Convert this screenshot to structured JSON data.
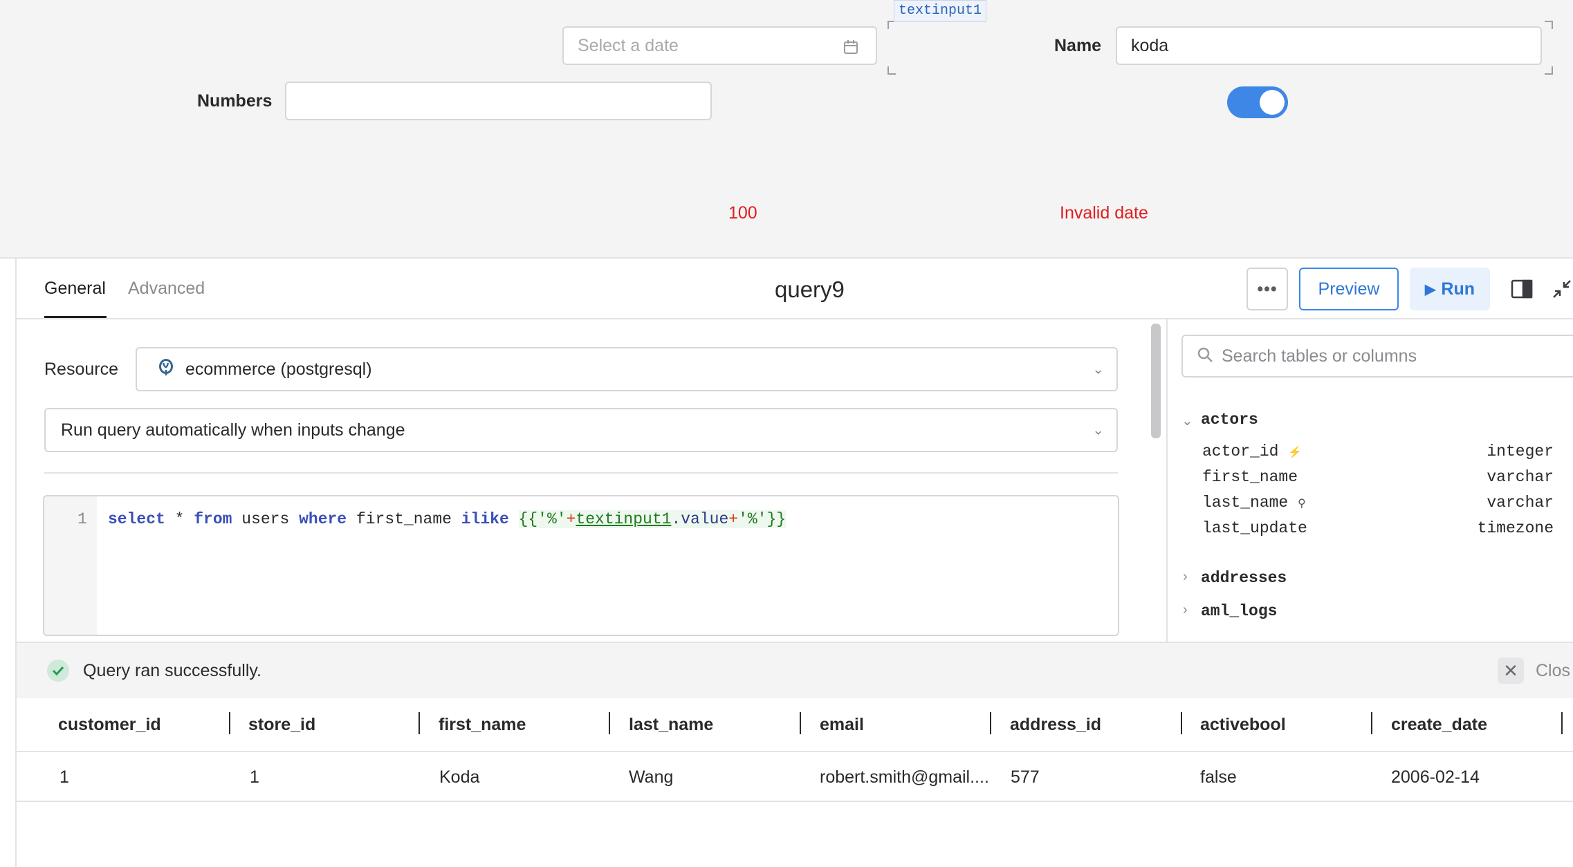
{
  "canvas": {
    "date_input": {
      "placeholder": "Select a date",
      "icon": "calendar-icon"
    },
    "numbers_field": {
      "label": "Numbers",
      "value": ""
    },
    "name_field": {
      "label": "Name",
      "value": "koda",
      "component_tag": "textinput1"
    },
    "toggle": {
      "state": "on",
      "color": "#3e87e6"
    },
    "number_text": "100",
    "date_error_text": "Invalid date",
    "error_color": "#e11d1d"
  },
  "editor": {
    "tabs": [
      {
        "label": "General",
        "active": true
      },
      {
        "label": "Advanced",
        "active": false
      }
    ],
    "query_name": "query9",
    "buttons": {
      "more": "•••",
      "preview": "Preview",
      "run": "Run"
    },
    "resource": {
      "label": "Resource",
      "value": "ecommerce (postgresql)",
      "icon": "postgresql-elephant-icon"
    },
    "trigger": {
      "value": "Run query automatically when inputs change"
    },
    "code": {
      "line_number": "1",
      "kw_select": "select",
      "star": " * ",
      "kw_from": "from",
      "table": " users ",
      "kw_where": "where",
      "column": " first_name ",
      "kw_ilike": "ilike",
      "t_open": "{{'%'",
      "t_plus1": "+",
      "t_ref": "textinput1",
      "t_prop": ".value",
      "t_plus2": "+",
      "t_close": "'%'}}"
    }
  },
  "schema": {
    "search_placeholder": "Search tables or columns",
    "tables": [
      {
        "name": "actors",
        "expanded": true,
        "columns": [
          {
            "name": "actor_id",
            "type": "integer",
            "icon": "primary-key-icon"
          },
          {
            "name": "first_name",
            "type": "varchar"
          },
          {
            "name": "last_name",
            "type": "varchar",
            "icon": "index-icon"
          },
          {
            "name": "last_update",
            "type": "timezone"
          }
        ]
      },
      {
        "name": "addresses",
        "expanded": false
      },
      {
        "name": "aml_logs",
        "expanded": false
      }
    ]
  },
  "results": {
    "status": "Query ran successfully.",
    "close_label": "Clos",
    "headers": [
      "customer_id",
      "store_id",
      "first_name",
      "last_name",
      "email",
      "address_id",
      "activebool",
      "create_date"
    ],
    "rows": [
      [
        "1",
        "1",
        "Koda",
        "Wang",
        "robert.smith@gmail....",
        "577",
        "false",
        "2006-02-14"
      ]
    ]
  }
}
